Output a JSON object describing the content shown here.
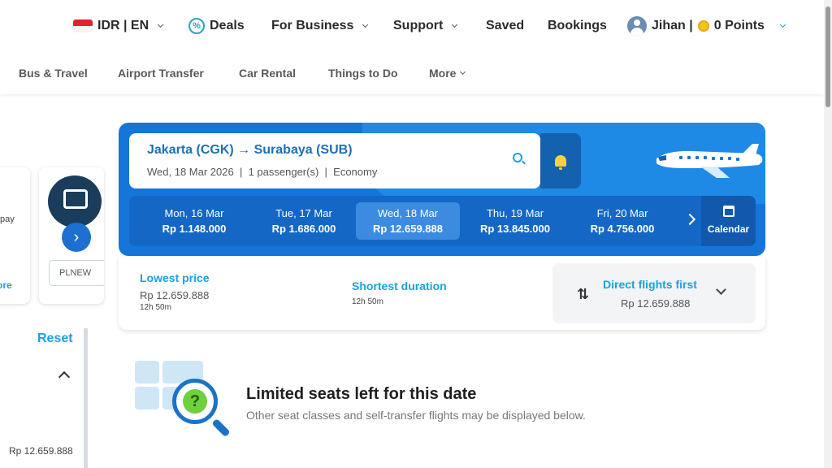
{
  "topnav": {
    "lang": "IDR | EN",
    "deals": "Deals",
    "business": "For Business",
    "support": "Support",
    "saved": "Saved",
    "bookings": "Bookings",
    "user_name": "Jihan |",
    "points": "0 Points"
  },
  "subnav": {
    "items": [
      "Bus & Travel",
      "Airport Transfer",
      "Car Rental",
      "Things to Do",
      "More"
    ]
  },
  "left_panel": {
    "pay_text": "pay",
    "more_text": "ore",
    "promo_code": "PLNEW",
    "reset": "Reset",
    "price": "Rp 12.659.888"
  },
  "search": {
    "route": "Jakarta (CGK) → Surabaya (SUB)",
    "date": "Wed, 18 Mar 2026",
    "passengers": "1 passenger(s)",
    "cabin": "Economy",
    "separator": "|"
  },
  "dates": [
    {
      "day": "Mon, 16 Mar",
      "price": "Rp 1.148.000",
      "selected": false
    },
    {
      "day": "Tue, 17 Mar",
      "price": "Rp 1.686.000",
      "selected": false
    },
    {
      "day": "Wed, 18 Mar",
      "price": "Rp 12.659.888",
      "selected": true
    },
    {
      "day": "Thu, 19 Mar",
      "price": "Rp 13.845.000",
      "selected": false
    },
    {
      "day": "Fri, 20 Mar",
      "price": "Rp 4.756.000",
      "selected": false
    }
  ],
  "calendar_label": "Calendar",
  "sort": {
    "lowest_label": "Lowest price",
    "lowest_price": "Rp 12.659.888",
    "lowest_duration": "12h 50m",
    "shortest_label": "Shortest duration",
    "shortest_duration": "12h 50m",
    "direct_label": "Direct flights first",
    "direct_price": "Rp 12.659.888"
  },
  "limited": {
    "title": "Limited seats left for this date",
    "subtitle": "Other seat classes and self-transfer flights may be displayed below.",
    "qmark": "?"
  },
  "colors": {
    "brand_blue": "#1575d8",
    "link_blue": "#1ba0e2"
  }
}
